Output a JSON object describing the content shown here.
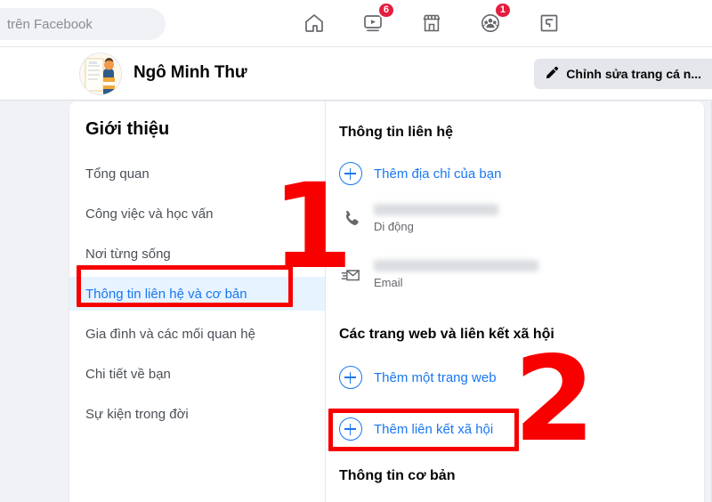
{
  "topbar": {
    "search_text": "trên Facebook",
    "nav_items": [
      {
        "name": "home-icon",
        "label": "Trang chủ",
        "badge": null
      },
      {
        "name": "watch-icon",
        "label": "Video",
        "badge": "6"
      },
      {
        "name": "marketplace-icon",
        "label": "Marketplace",
        "badge": null
      },
      {
        "name": "groups-icon",
        "label": "Nhóm",
        "badge": "1"
      },
      {
        "name": "gaming-icon",
        "label": "Chơi game",
        "badge": null
      }
    ]
  },
  "profile": {
    "name": "Ngô Minh Thư",
    "edit_button": "Chỉnh sửa trang cá n..."
  },
  "sidebar": {
    "title": "Giới thiệu",
    "items": [
      {
        "label": "Tổng quan",
        "active": false
      },
      {
        "label": "Công việc và học vấn",
        "active": false
      },
      {
        "label": "Nơi từng sống",
        "active": false
      },
      {
        "label": "Thông tin liên hệ và cơ bản",
        "active": true
      },
      {
        "label": "Gia đình và các mối quan hệ",
        "active": false
      },
      {
        "label": "Chi tiết về bạn",
        "active": false
      },
      {
        "label": "Sự kiện trong đời",
        "active": false
      }
    ]
  },
  "content": {
    "contact_section_title": "Thông tin liên hệ",
    "add_address_label": "Thêm địa chỉ của bạn",
    "phone_value": "",
    "phone_label": "Di động",
    "email_value": "",
    "email_label": "Email",
    "websites_section_title": "Các trang web và liên kết xã hội",
    "add_website_label": "Thêm một trang web",
    "add_social_label": "Thêm liên kết xã hội",
    "basic_section_title": "Thông tin cơ bản"
  },
  "annotations": {
    "step_one": "1",
    "step_two": "2",
    "highlight_color": "#f80000"
  },
  "colors": {
    "page_bg": "#f0f2f5",
    "card_bg": "#ffffff",
    "link_blue": "#1877f2",
    "active_bg": "#e7f3ff",
    "badge_red": "#e41e3f",
    "text_primary": "#050505",
    "text_secondary": "#65676b"
  }
}
